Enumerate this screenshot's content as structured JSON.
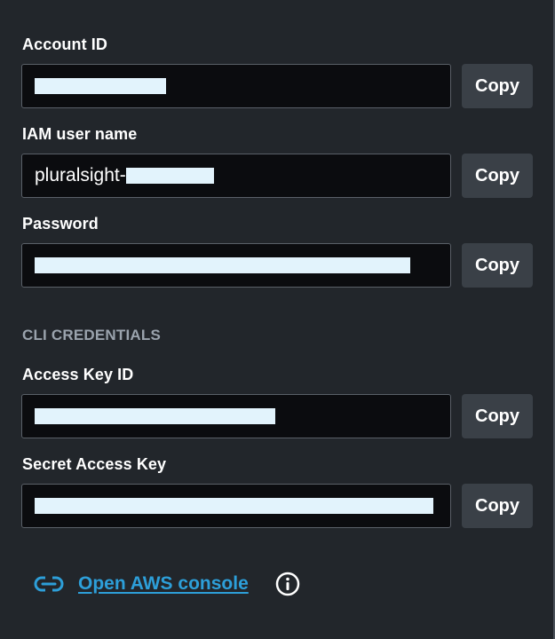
{
  "account_id": {
    "label": "Account ID",
    "value_visible": "",
    "copy_label": "Copy"
  },
  "iam_user_name": {
    "label": "IAM user name",
    "value_visible": "pluralsight-",
    "copy_label": "Copy"
  },
  "password": {
    "label": "Password",
    "value_visible": "",
    "copy_label": "Copy"
  },
  "cli_credentials": {
    "heading": "CLI CREDENTIALS"
  },
  "access_key_id": {
    "label": "Access Key ID",
    "value_visible": "",
    "copy_label": "Copy"
  },
  "secret_access_key": {
    "label": "Secret Access Key",
    "value_visible": "",
    "copy_label": "Copy"
  },
  "footer": {
    "link_label": "Open AWS console",
    "link_icon": "link-icon",
    "info_icon": "info-icon"
  },
  "colors": {
    "background": "#22262b",
    "field_background": "#0b0c0f",
    "redaction": "#e2f3fc",
    "link": "#2d9fd9",
    "copy_button": "#3a4047"
  }
}
